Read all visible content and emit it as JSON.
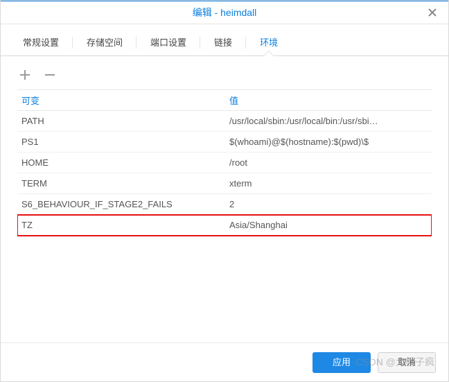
{
  "header": {
    "title": "编辑 - heimdall"
  },
  "tabs": [
    {
      "label": "常规设置",
      "active": false
    },
    {
      "label": "存储空间",
      "active": false
    },
    {
      "label": "端口设置",
      "active": false
    },
    {
      "label": "链接",
      "active": false
    },
    {
      "label": "环境",
      "active": true
    }
  ],
  "toolbar": {
    "add_icon": "plus-icon",
    "remove_icon": "minus-icon"
  },
  "table": {
    "columns": {
      "variable": "可变",
      "value": "值"
    },
    "rows": [
      {
        "variable": "PATH",
        "value": "/usr/local/sbin:/usr/local/bin:/usr/sbi…"
      },
      {
        "variable": "PS1",
        "value": "$(whoami)@$(hostname):$(pwd)\\$"
      },
      {
        "variable": "HOME",
        "value": "/root"
      },
      {
        "variable": "TERM",
        "value": "xterm"
      },
      {
        "variable": "S6_BEHAVIOUR_IF_STAGE2_FAILS",
        "value": "2"
      },
      {
        "variable": "TZ",
        "value": "Asia/Shanghai",
        "highlighted": true
      }
    ]
  },
  "footer": {
    "apply": "应用",
    "cancel": "取消"
  },
  "watermark": "CSDN @大橙子疯",
  "colors": {
    "accent": "#0a7fe0",
    "primary_btn": "#1e88e5",
    "highlight_border": "#e61111"
  }
}
